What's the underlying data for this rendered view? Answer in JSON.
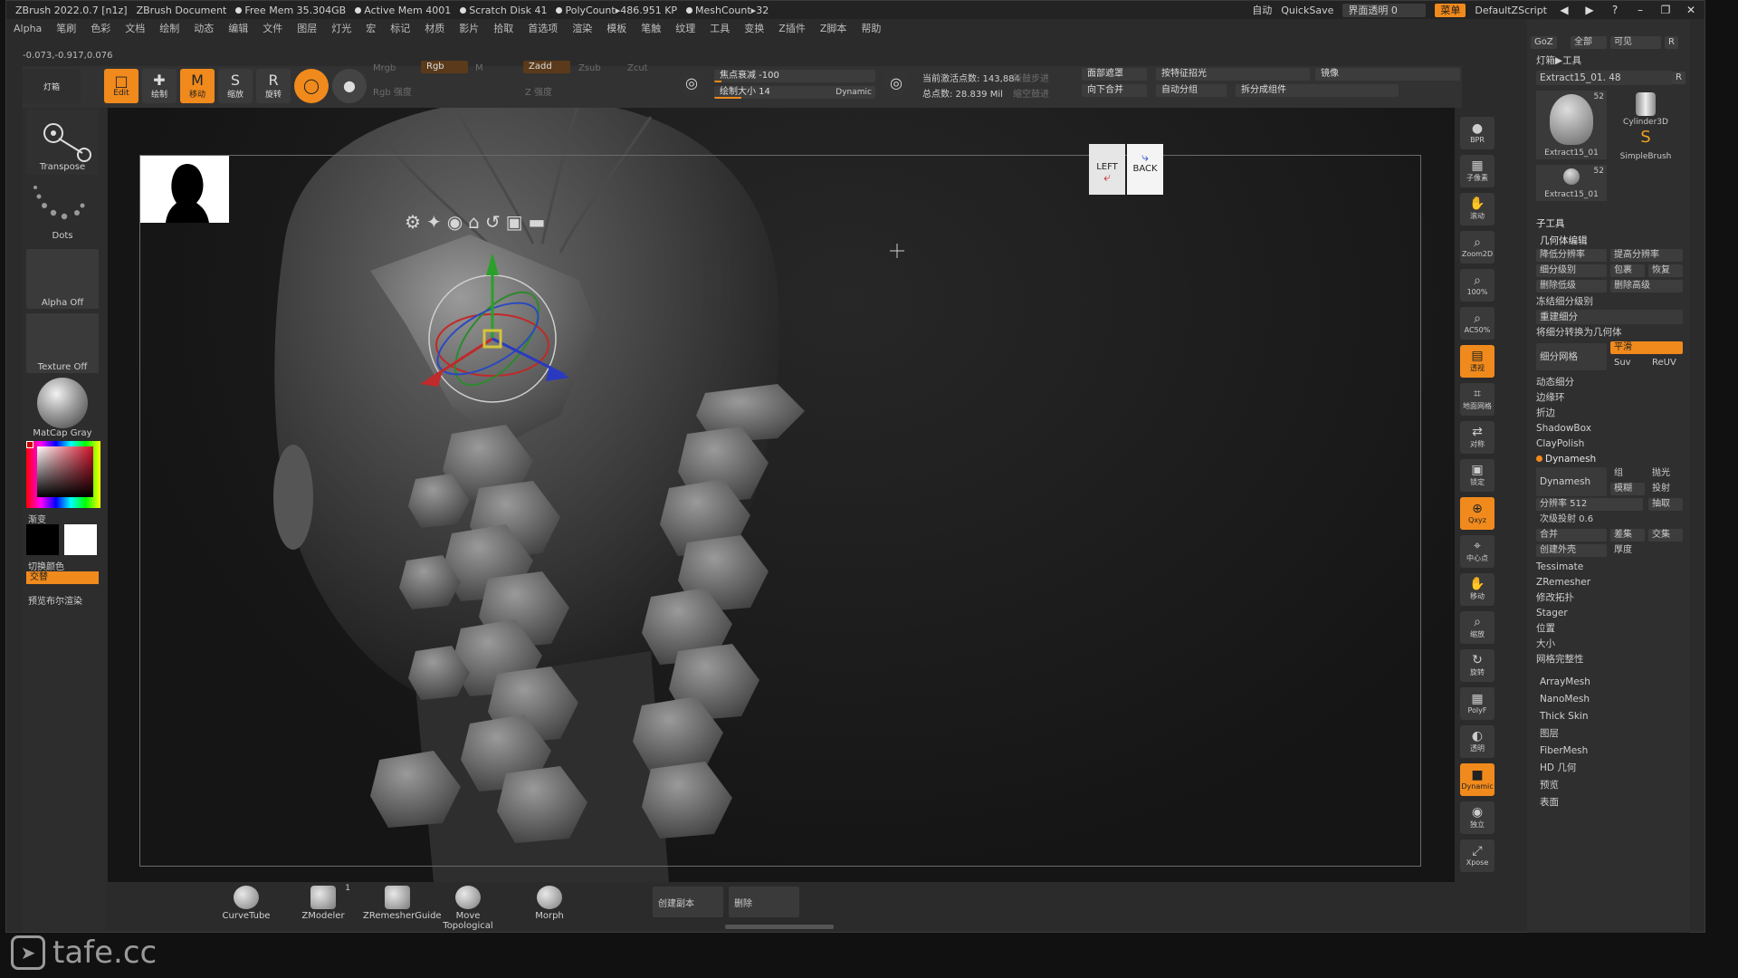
{
  "titlebar": {
    "app": "ZBrush 2022.0.7 [n1z]",
    "doc": "ZBrush Document",
    "free_mem": "Free Mem 35.304GB",
    "active_mem": "Active Mem 4001",
    "scratch": "Scratch Disk 41",
    "polycount": "PolyCount▸486.951 KP",
    "meshcount": "MeshCount▸32",
    "auto": "自动",
    "quicksave": "QuickSave",
    "transparency": "界面透明 0",
    "menu_btn": "菜单",
    "script": "DefaultZScript"
  },
  "menus": [
    "Alpha",
    "笔刷",
    "色彩",
    "文档",
    "绘制",
    "动态",
    "编辑",
    "文件",
    "图层",
    "灯光",
    "宏",
    "标记",
    "材质",
    "影片",
    "拾取",
    "首选项",
    "渲染",
    "模板",
    "笔触",
    "纹理",
    "工具",
    "变换",
    "Z插件",
    "Z脚本",
    "帮助"
  ],
  "coord_readout": "-0.073,-0.917,0.076",
  "toolstrip": {
    "lightbox": "灯箱",
    "edit": "Edit",
    "draw": "绘制",
    "move": "移动",
    "scale": "缩放",
    "rotate": "旋转",
    "mrgb": "Mrgb",
    "rgb": "Rgb",
    "m": "M",
    "rgb_intensity": "Rgb 强度",
    "zadd": "Zadd",
    "zsub": "Zsub",
    "zcut": "Zcut",
    "z_intensity": "Z 强度",
    "focal_shift": "焦点衰减 -100",
    "draw_size": "绘制大小 14",
    "dynamic": "Dynamic",
    "active_points": "当前激活点数: 143,884",
    "total_points": "总点数: 28.839 Mil",
    "sym_label_1": "面部遮罩",
    "sym_label_2": "向下合并",
    "auto_group": "自动分组",
    "by_feature": "按特征招光",
    "split_groups": "拆分成组件",
    "mirror": "镜像",
    "fade_1": "新鼓步进",
    "fade_2": "缩空鼓进"
  },
  "leftpanel": {
    "transpose": "Transpose",
    "dots": "Dots",
    "alpha": "Alpha Off",
    "texture": "Texture Off",
    "material": "MatCap Gray",
    "gradient": "渐变",
    "switch_color": "切换颜色",
    "alternate": "交替",
    "preview": "预览布尔渲染"
  },
  "viewport": {
    "nav_left": "LEFT",
    "nav_back": "BACK"
  },
  "rightshelf": [
    "BPR",
    "子像素",
    "滚动",
    "Zoom2D",
    "100%",
    "AC50%",
    "透视",
    "地面网格",
    "对称",
    "锁定",
    "Qxyz",
    "中心点",
    "移动",
    "缩放",
    "旋转",
    "PolyF",
    "透明",
    "Dynamic",
    "独立",
    "Xpose"
  ],
  "rightpanel": {
    "goz": "GoZ",
    "all": "全部",
    "visible": "可见",
    "r": "R",
    "lightbox_tool": "灯箱▶工具",
    "current_tool": "Extract15_01. 48",
    "thumb1_label": "Extract15_01",
    "thumb1_count": "52",
    "thumb2_label": "Cylinder3D",
    "thumb3_label": "SimpleBrush",
    "thumb4_label": "Extract15_01",
    "thumb4_count": "52",
    "subtool": "子工具",
    "geometry_edit": "几何体编辑",
    "lower_res": "降低分辨率",
    "higher_res": "提高分辨率",
    "subdiv_level": "细分级别",
    "cage": "包裹",
    "restore": "恢复",
    "del_lower": "删除低级",
    "del_higher": "删除高级",
    "freeze_subdiv": "冻结细分级别",
    "reconstruct": "重建细分",
    "convert": "将细分转换为几何体",
    "divide": "细分网格",
    "smooth": "平滑",
    "suv": "Suv",
    "reuv": "ReUV",
    "dynamic_subdiv": "动态细分",
    "edge_loop": "边缘环",
    "crease": "折边",
    "shadowbox": "ShadowBox",
    "claypolish": "ClayPolish",
    "dynamesh_head": "Dynamesh",
    "dynamesh": "Dynamesh",
    "group": "组",
    "polish": "抛光",
    "blur": "模糊",
    "project": "投射",
    "resolution": "分辨率 512",
    "extract": "抽取",
    "sub_projection": "次级投射 0.6",
    "merge": "合并",
    "difference": "差集",
    "intersect": "交集",
    "create_shell": "创建外壳",
    "thickness": "厚度",
    "tessimate": "Tessimate",
    "zremesher": "ZRemesher",
    "modify_topo": "修改拓扑",
    "stager": "Stager",
    "position": "位置",
    "size": "大小",
    "mesh_integrity": "网格完整性",
    "arraymesh": "ArrayMesh",
    "nanomesh": "NanoMesh",
    "thickskin": "Thick Skin",
    "layers": "图层",
    "fibermesh": "FiberMesh",
    "hd_geometry": "HD 几何",
    "preview": "预览",
    "surface": "表面"
  },
  "bottombar": {
    "curvetube": "CurveTube",
    "zmodeler": "ZModeler",
    "zmodeler_count": "1",
    "zremesherguide": "ZRemesherGuide",
    "movetopo": "Move Topological",
    "morph": "Morph",
    "create_copy": "创建副本",
    "delete": "删除"
  },
  "watermark": "tafe.cc",
  "colors": {
    "accent": "#f08a1c",
    "panel": "#2f2f2f",
    "background": "#111111"
  }
}
